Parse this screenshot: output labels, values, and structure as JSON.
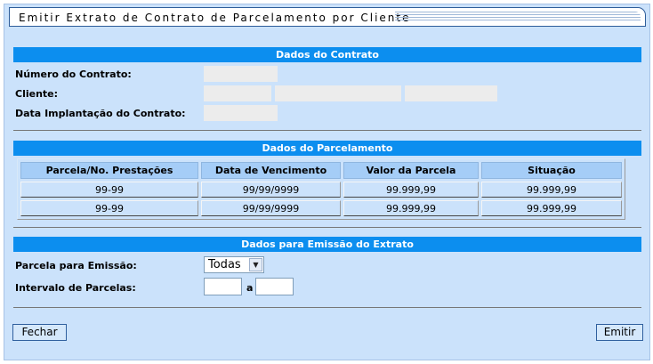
{
  "title": "Emitir Extrato de Contrato de Parcelamento por Cliente",
  "dados_contrato": {
    "header": "Dados do Contrato",
    "numero_label": "Número do Contrato:",
    "cliente_label": "Cliente:",
    "data_label": "Data Implantação do Contrato:"
  },
  "dados_parcelamento": {
    "header": "Dados do Parcelamento",
    "columns": [
      "Parcela/No. Prestações",
      "Data de Vencimento",
      "Valor da Parcela",
      "Situação"
    ],
    "rows": [
      [
        "99-99",
        "99/99/9999",
        "99.999,99",
        "99.999,99"
      ],
      [
        "99-99",
        "99/99/9999",
        "99.999,99",
        "99.999,99"
      ]
    ]
  },
  "dados_emissao": {
    "header": "Dados para Emissão do Extrato",
    "parcela_label": "Parcela para Emissão:",
    "parcela_value": "Todas",
    "intervalo_label": "Intervalo de Parcelas:",
    "intervalo_sep": "a"
  },
  "buttons": {
    "fechar": "Fechar",
    "emitir": "Emitir"
  },
  "colors": {
    "section_bar": "#0c8eef",
    "panel_bg": "#cbe2fb",
    "table_header": "#a5cdf7"
  }
}
